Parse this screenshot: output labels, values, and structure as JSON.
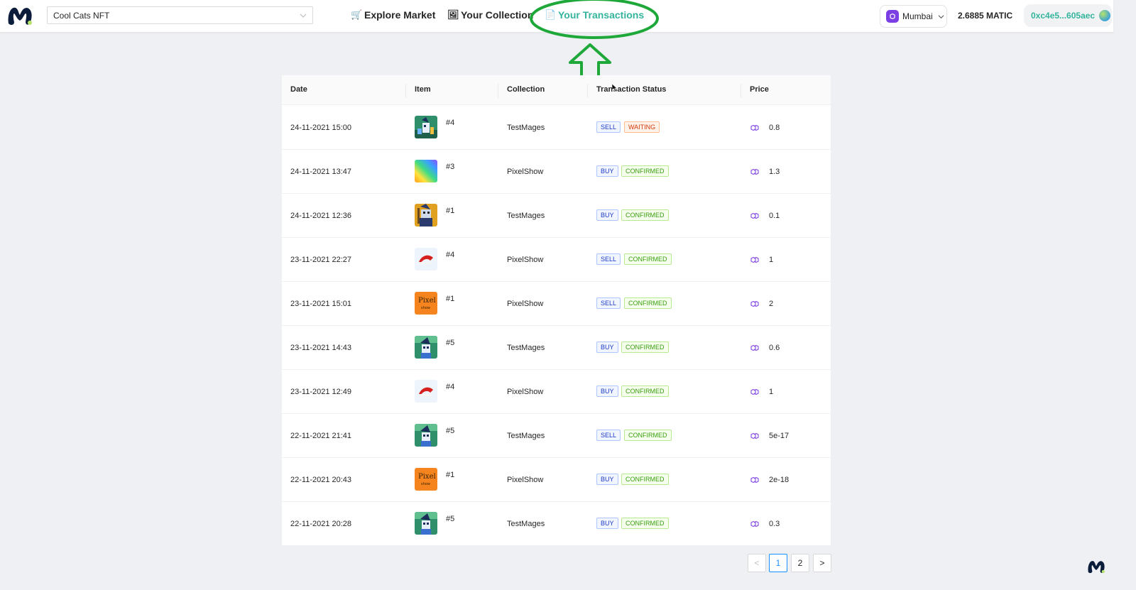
{
  "header": {
    "search_value": "Cool Cats NFT",
    "nav": [
      {
        "icon": "🛒",
        "label": "Explore Market"
      },
      {
        "icon": "🖼",
        "label": "Your Collection"
      },
      {
        "icon": "📄",
        "label": "Your Transactions"
      }
    ],
    "network": "Mumbai",
    "balance": "2.6885 MATIC",
    "wallet": "0xc4e5...605aec"
  },
  "table": {
    "columns": [
      "Date",
      "Item",
      "Collection",
      "Transaction Status",
      "Price"
    ],
    "rows": [
      {
        "date": "24-11-2021 15:00",
        "item": "#4",
        "thumb": "mage-a",
        "collection": "TestMages",
        "type": "SELL",
        "status": "WAITING",
        "price": "0.8"
      },
      {
        "date": "24-11-2021 13:47",
        "item": "#3",
        "thumb": "rainbow",
        "collection": "PixelShow",
        "type": "BUY",
        "status": "CONFIRMED",
        "price": "1.3"
      },
      {
        "date": "24-11-2021 12:36",
        "item": "#1",
        "thumb": "mage-b",
        "collection": "TestMages",
        "type": "BUY",
        "status": "CONFIRMED",
        "price": "0.1"
      },
      {
        "date": "23-11-2021 22:27",
        "item": "#4",
        "thumb": "hat",
        "collection": "PixelShow",
        "type": "SELL",
        "status": "CONFIRMED",
        "price": "1"
      },
      {
        "date": "23-11-2021 15:01",
        "item": "#1",
        "thumb": "pixel",
        "collection": "PixelShow",
        "type": "SELL",
        "status": "CONFIRMED",
        "price": "2"
      },
      {
        "date": "23-11-2021 14:43",
        "item": "#5",
        "thumb": "mage-c",
        "collection": "TestMages",
        "type": "BUY",
        "status": "CONFIRMED",
        "price": "0.6"
      },
      {
        "date": "23-11-2021 12:49",
        "item": "#4",
        "thumb": "hat",
        "collection": "PixelShow",
        "type": "BUY",
        "status": "CONFIRMED",
        "price": "1"
      },
      {
        "date": "22-11-2021 21:41",
        "item": "#5",
        "thumb": "mage-c",
        "collection": "TestMages",
        "type": "SELL",
        "status": "CONFIRMED",
        "price": "5e-17"
      },
      {
        "date": "22-11-2021 20:43",
        "item": "#1",
        "thumb": "pixel",
        "collection": "PixelShow",
        "type": "BUY",
        "status": "CONFIRMED",
        "price": "2e-18"
      },
      {
        "date": "22-11-2021 20:28",
        "item": "#5",
        "thumb": "mage-c",
        "collection": "TestMages",
        "type": "BUY",
        "status": "CONFIRMED",
        "price": "0.3"
      }
    ]
  },
  "pagination": {
    "prev": "<",
    "pages": [
      "1",
      "2"
    ],
    "next": ">",
    "current": "1"
  },
  "colors": {
    "accent": "#34b49c",
    "annotation": "#1fa83a",
    "polygon": "#7b3fe4"
  }
}
